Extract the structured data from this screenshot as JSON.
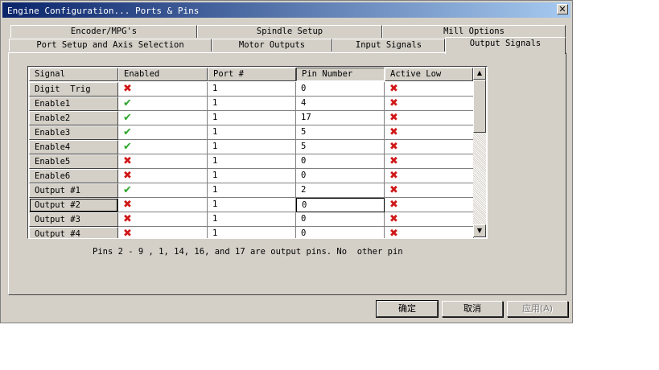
{
  "window": {
    "title": "Engine Configuration... Ports & Pins"
  },
  "tabs": {
    "row_back": [
      "Encoder/MPG's",
      "Spindle Setup",
      "Mill Options"
    ],
    "row_front": [
      "Port Setup and Axis Selection",
      "Motor Outputs",
      "Input Signals",
      "Output Signals"
    ],
    "active": "Output Signals"
  },
  "grid": {
    "headers": [
      "Signal",
      "Enabled",
      "Port #",
      "Pin Number",
      "Active Low"
    ],
    "rows": [
      {
        "signal": "Digit  Trig",
        "enabled": false,
        "port": "1",
        "pin": "0",
        "active_low": false
      },
      {
        "signal": "Enable1",
        "enabled": true,
        "port": "1",
        "pin": "4",
        "active_low": false
      },
      {
        "signal": "Enable2",
        "enabled": true,
        "port": "1",
        "pin": "17",
        "active_low": false
      },
      {
        "signal": "Enable3",
        "enabled": true,
        "port": "1",
        "pin": "5",
        "active_low": false
      },
      {
        "signal": "Enable4",
        "enabled": true,
        "port": "1",
        "pin": "5",
        "active_low": false
      },
      {
        "signal": "Enable5",
        "enabled": false,
        "port": "1",
        "pin": "0",
        "active_low": false
      },
      {
        "signal": "Enable6",
        "enabled": false,
        "port": "1",
        "pin": "0",
        "active_low": false
      },
      {
        "signal": "Output #1",
        "enabled": true,
        "port": "1",
        "pin": "2",
        "active_low": false
      },
      {
        "signal": "Output #2",
        "enabled": false,
        "port": "1",
        "pin": "0",
        "active_low": false
      },
      {
        "signal": "Output #3",
        "enabled": false,
        "port": "1",
        "pin": "0",
        "active_low": false
      },
      {
        "signal": "Output #4",
        "enabled": false,
        "port": "1",
        "pin": "0",
        "active_low": false
      }
    ],
    "glyphs": {
      "check": "✔",
      "cross": "✖"
    }
  },
  "hint": "Pins 2 - 9 , 1, 14, 16, and 17 are output pins. No  other pin",
  "buttons": {
    "ok": "确定",
    "cancel": "取消",
    "apply": "应用(A)"
  },
  "scrollbar": {
    "up": "▲",
    "down": "▼"
  },
  "close_glyph": "✕",
  "colors": {
    "titlebar_start": "#0a246a",
    "check": "#2aa52a",
    "cross": "#d01818"
  }
}
